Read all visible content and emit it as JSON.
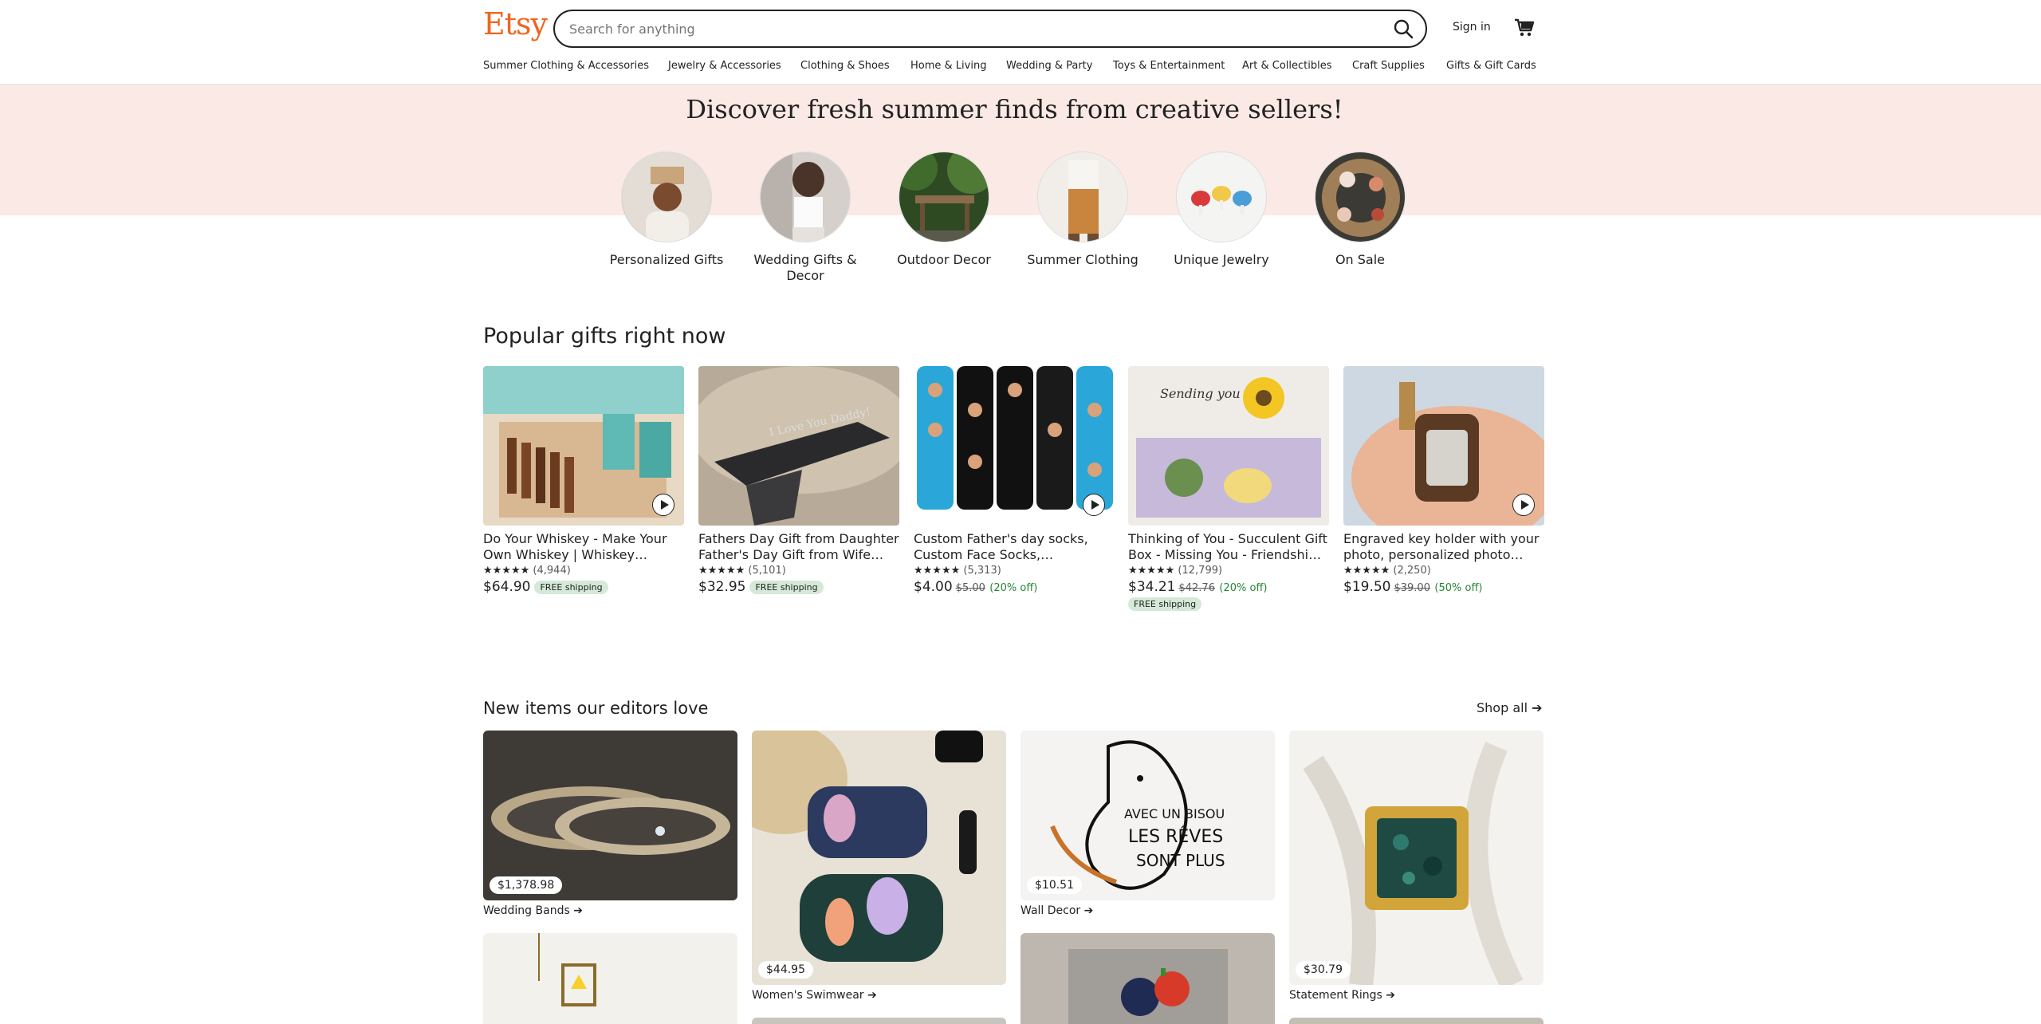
{
  "header": {
    "logo": "Etsy",
    "search_placeholder": "Search for anything",
    "search_icon": "search-icon",
    "signin": "Sign in",
    "cart_icon": "cart-icon"
  },
  "nav": [
    "Summer Clothing & Accessories",
    "Jewelry & Accessories",
    "Clothing & Shoes",
    "Home & Living",
    "Wedding & Party",
    "Toys & Entertainment",
    "Art & Collectibles",
    "Craft Supplies",
    "Gifts & Gift Cards"
  ],
  "hero": {
    "title": "Discover fresh summer finds from creative sellers!",
    "categories": [
      {
        "label": "Personalized Gifts"
      },
      {
        "label": "Wedding Gifts & Decor"
      },
      {
        "label": "Outdoor Decor"
      },
      {
        "label": "Summer Clothing"
      },
      {
        "label": "Unique Jewelry"
      },
      {
        "label": "On Sale"
      }
    ],
    "background": "#fae9e4"
  },
  "popular": {
    "title": "Popular gifts right now",
    "items": [
      {
        "title": "Do Your Whiskey - Make Your Own Whiskey | Whiskey Making Kit",
        "stars": "★★★★★",
        "count": "(4,944)",
        "price": "$64.90",
        "old_price": "",
        "discount": "",
        "shipping": "FREE shipping",
        "video": true
      },
      {
        "title": "Fathers Day Gift from Daughter Father's Day Gift from Wife First Father's Day",
        "stars": "★★★★★",
        "count": "(5,101)",
        "price": "$32.95",
        "old_price": "",
        "discount": "",
        "shipping": "FREE shipping",
        "video": false
      },
      {
        "title": "Custom Father's day socks, Custom Face Socks, Personalized",
        "stars": "★★★★★",
        "count": "(5,313)",
        "price": "$4.00",
        "old_price": "$5.00",
        "discount": "(20% off)",
        "shipping": "",
        "video": true
      },
      {
        "title": "Thinking of You - Succulent Gift Box - Missing You - Friendship Gift",
        "stars": "★★★★★",
        "count": "(12,799)",
        "price": "$34.21",
        "old_price": "$42.76",
        "discount": "(20% off)",
        "shipping": "FREE shipping",
        "video": false
      },
      {
        "title": "Engraved key holder with your photo, personalized photo keychain",
        "stars": "★★★★★",
        "count": "(2,250)",
        "price": "$19.50",
        "old_price": "$39.00",
        "discount": "(50% off)",
        "shipping": "",
        "video": true
      }
    ]
  },
  "editors": {
    "title": "New items our editors love",
    "shop_all": "Shop all",
    "arrow_icon": "arrow-right-icon",
    "items": [
      {
        "price": "$1,378.98",
        "caption": "Wedding Bands"
      },
      {
        "price": "$44.95",
        "caption": "Women's Swimwear"
      },
      {
        "price": "$10.51",
        "caption": "Wall Decor"
      },
      {
        "price": "$30.79",
        "caption": "Statement Rings"
      }
    ]
  },
  "colors": {
    "brand": "#f1641e",
    "text": "#222222",
    "discount": "#258635",
    "free_shipping_bg": "#d4e9d7"
  }
}
